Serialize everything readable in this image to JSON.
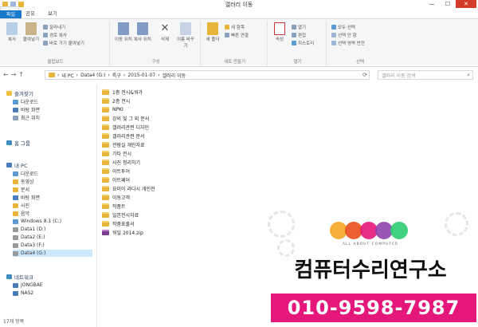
{
  "window": {
    "title": "갤러리 이동",
    "controls": {
      "minimize": "—",
      "maximize": "☐",
      "close": "✕"
    }
  },
  "quick_access": [
    "folder-icon",
    "properties-icon",
    "new-folder-icon"
  ],
  "tabs": [
    {
      "label": "파일"
    },
    {
      "label": "홈"
    },
    {
      "label": "공유"
    },
    {
      "label": "보기"
    }
  ],
  "ribbon": {
    "clipboard": {
      "label": "클립보드",
      "copy": "복사",
      "paste": "붙여넣기",
      "cut": "잘라내기",
      "copy_path": "경로 복사",
      "paste_shortcut": "바로 가기 붙여넣기"
    },
    "organize": {
      "label": "구성",
      "move_to": "이동 위치",
      "copy_to": "복사 위치",
      "delete": "삭제",
      "rename": "이름 바꾸기"
    },
    "new": {
      "label": "새로 만들기",
      "new_folder": "새 폴더",
      "new_item": "새 항목",
      "easy_access": "빠른 연결"
    },
    "open": {
      "label": "열기",
      "properties": "속성",
      "open": "열기",
      "edit": "편집",
      "history": "히스토리"
    },
    "select": {
      "label": "선택",
      "select_all": "모두 선택",
      "select_none": "선택 안 함",
      "invert": "선택 영역 반전"
    }
  },
  "address": {
    "nav": {
      "back": "←",
      "forward": "→",
      "up": "↑"
    },
    "crumbs": [
      "내 PC",
      "Data4 (G:)",
      "특구",
      "2015-01-07",
      "갤러리 이동"
    ],
    "separator": "›",
    "search_placeholder": "갤러리 이동 검색"
  },
  "navpane": {
    "favorites": {
      "label": "즐겨찾기",
      "items": [
        "다운로드",
        "바탕 화면",
        "최근 위치"
      ]
    },
    "homegroup": "홈 그룹",
    "this_pc": {
      "label": "내 PC",
      "items": [
        "다운로드",
        "동영상",
        "문서",
        "바탕 화면",
        "사진",
        "음악",
        "Windows 8.1 (C:)",
        "Data1 (D:)",
        "Data2 (E:)",
        "Data3 (F:)",
        "Data4 (G:)"
      ]
    },
    "network": {
      "label": "네트워크",
      "items": [
        "JONGBAE",
        "NAS2"
      ]
    }
  },
  "files": [
    {
      "name": "1층 전시&워가",
      "type": "folder"
    },
    {
      "name": "2층 전시",
      "type": "folder"
    },
    {
      "name": "NPKI",
      "type": "folder"
    },
    {
      "name": "강의 및 그 외 문서",
      "type": "folder"
    },
    {
      "name": "갤러리관련 디자인",
      "type": "folder"
    },
    {
      "name": "갤러리관련 문서",
      "type": "folder"
    },
    {
      "name": "관람실 개인자료",
      "type": "folder"
    },
    {
      "name": "기타 전시",
      "type": "folder"
    },
    {
      "name": "사진 정리하기",
      "type": "folder"
    },
    {
      "name": "아트투어",
      "type": "folder"
    },
    {
      "name": "아트페어",
      "type": "folder"
    },
    {
      "name": "요미아 라다시 개인전",
      "type": "folder"
    },
    {
      "name": "이동고객",
      "type": "folder"
    },
    {
      "name": "작품트",
      "type": "folder"
    },
    {
      "name": "일본전시자료",
      "type": "folder"
    },
    {
      "name": "작품표출서",
      "type": "folder"
    },
    {
      "name": "워일 2014.zip",
      "type": "zip"
    }
  ],
  "status": "17개 항목",
  "ad": {
    "tagline": "ALL ABOUT COMPUTER",
    "brand": "컴퓨터수리연구소",
    "phone": "010-9598-7987",
    "circle_colors": [
      "#f5a623",
      "#e94e1b",
      "#e6177a",
      "#8e44ad",
      "#2ecc71"
    ],
    "phone_bg": "#e6177a"
  }
}
